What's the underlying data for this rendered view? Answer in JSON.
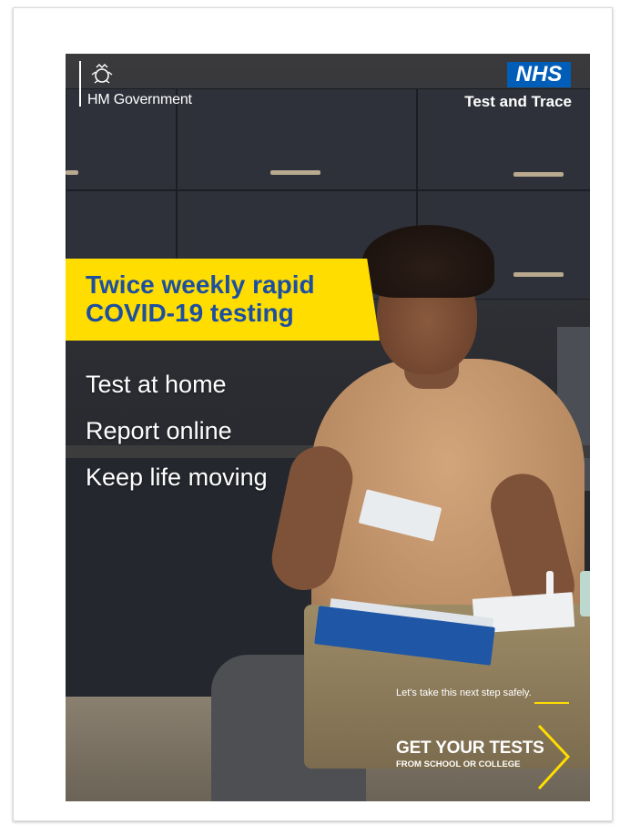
{
  "branding": {
    "government_name": "HM Government",
    "nhs_logo": "NHS",
    "nhs_service": "Test and Trace",
    "crest_icon": "royal-crest-icon",
    "nhs_blue": "#005eb8"
  },
  "headline": {
    "text": "Twice weekly rapid COVID-19 testing",
    "band_color": "#ffdd00",
    "text_color": "#1d4fa1"
  },
  "bullets": [
    "Test at home",
    "Report online",
    "Keep life moving"
  ],
  "tagline": "Let's take this next step safely.",
  "cta": {
    "title": "GET YOUR TESTS",
    "subtitle": "FROM SCHOOL OR COLLEGE",
    "icon": "chevron-right-icon"
  }
}
